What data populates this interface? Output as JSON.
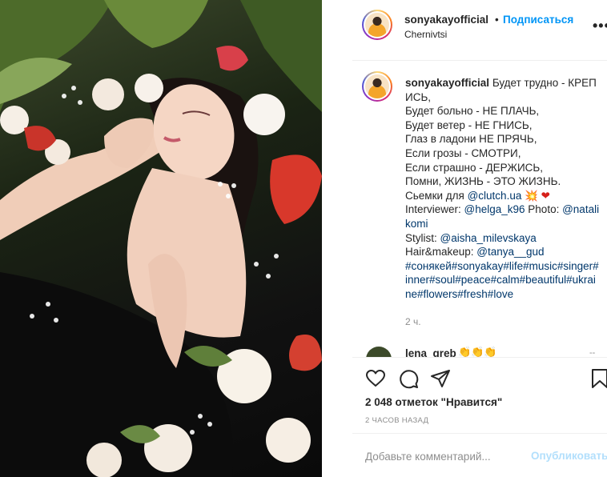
{
  "post": {
    "username": "sonyakayofficial",
    "follow_label": "Подписаться",
    "separator": "•",
    "location": "Chernivtsi",
    "more_label": "•••"
  },
  "caption": {
    "first_line": "Будет трудно - КРЕПИСЬ,",
    "lines": [
      "Будет больно - НЕ ПЛАЧЬ,",
      "Будет ветер - НЕ ГНИСЬ,",
      "Глаз в ладони НЕ ПРЯЧЬ,",
      "Если грозы - СМОТРИ,",
      "Если страшно - ДЕРЖИСЬ,",
      "Помни, ЖИЗНЬ - ЭТО ЖИЗНЬ."
    ],
    "shoot_prefix": "Сьемки для ",
    "shoot_link": "@clutch.ua",
    "shoot_emoji": " 💥 ❤",
    "interviewer_prefix": "Interviewer: ",
    "interviewer_link": "@helga_k96",
    "photo_prefix": " Photo: ",
    "photo_link": "@natalikomi",
    "stylist_prefix": "Stylist: ",
    "stylist_link": "@aisha_milevskaya",
    "hair_prefix": "Hair&makeup: ",
    "hair_link": "@tanya__gud",
    "hashtags": "#сонякей#sonyakay#life#music#singer#inner#soul#peace#calm#beautiful#ukraine#flowers#fresh#love",
    "time_ago": "2 ч."
  },
  "comment": {
    "username": "lena_greb",
    "emoji": "👏👏👏",
    "more": "--"
  },
  "actions": {
    "icons": [
      "heart-icon",
      "comment-icon",
      "share-icon",
      "bookmark-icon"
    ],
    "likes": "2 048 отметок \"Нравится\"",
    "posted": "2 ЧАСОВ НАЗАД"
  },
  "add_comment": {
    "placeholder": "Добавьте комментарий...",
    "publish_label": "Опубликовать"
  },
  "colors": {
    "accent": "#0095f6",
    "link": "#00376b",
    "muted": "#8e8e8e",
    "publish_disabled": "#b2dffc"
  }
}
